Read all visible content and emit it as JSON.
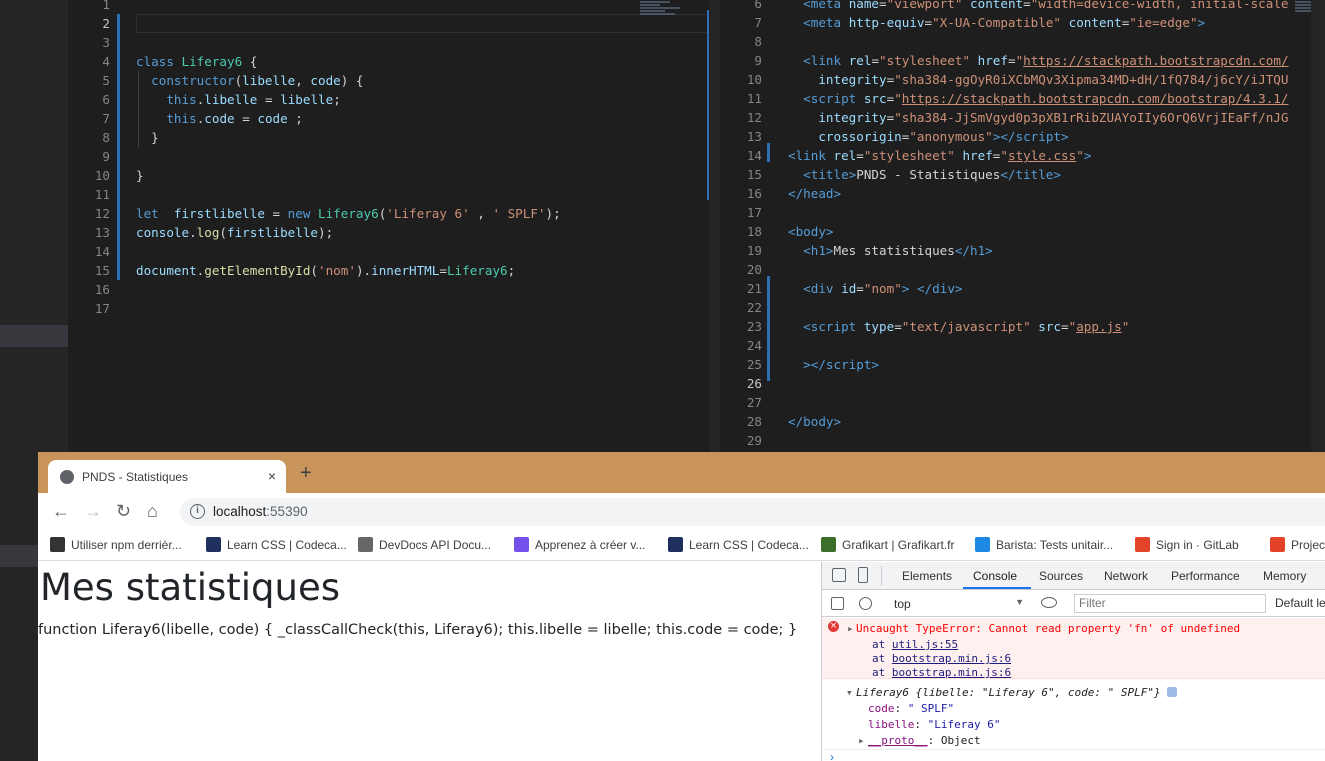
{
  "left_editor": {
    "lines": [
      {
        "n": "1",
        "html": ""
      },
      {
        "n": "2",
        "html": ""
      },
      {
        "n": "3",
        "html": ""
      },
      {
        "n": "4",
        "html": "<span class='t-key'>class</span> <span class='t-cls'>Liferay6</span> {"
      },
      {
        "n": "5",
        "html": "  <span class='t-key'>constructor</span>(<span class='t-var'>libelle</span>, <span class='t-var'>code</span>) {"
      },
      {
        "n": "6",
        "html": "    <span class='t-key'>this</span>.<span class='t-var'>libelle</span> = <span class='t-var'>libelle</span>;"
      },
      {
        "n": "7",
        "html": "    <span class='t-key'>this</span>.<span class='t-var'>code</span> = <span class='t-var'>code</span> ;"
      },
      {
        "n": "8",
        "html": "  }"
      },
      {
        "n": "9",
        "html": ""
      },
      {
        "n": "10",
        "html": "}"
      },
      {
        "n": "11",
        "html": ""
      },
      {
        "n": "12",
        "html": "<span class='t-key'>let</span>  <span class='t-var'>firstlibelle</span> = <span class='t-key'>new</span> <span class='t-cls'>Liferay6</span>(<span class='t-str'>'Liferay 6'</span> , <span class='t-str'>' SPLF'</span>);"
      },
      {
        "n": "13",
        "html": "<span class='t-var'>console</span>.<span class='t-fn'>log</span>(<span class='t-var'>firstlibelle</span>);"
      },
      {
        "n": "14",
        "html": ""
      },
      {
        "n": "15",
        "html": "<span class='t-var'>document</span>.<span class='t-fn'>getElementById</span>(<span class='t-str'>'nom'</span>).<span class='t-var'>innerHTML</span>=<span class='t-cls'>Liferay6</span>;"
      },
      {
        "n": "16",
        "html": ""
      },
      {
        "n": "17",
        "html": ""
      }
    ]
  },
  "right_editor": {
    "lines": [
      {
        "n": "6",
        "html": "  <span class='t-tag'>&lt;meta</span> <span class='t-attr'>name</span>=<span class='t-aval'>\"viewport\"</span> <span class='t-attr'>content</span>=<span class='t-aval'>\"width=device-width, initial-scale</span>"
      },
      {
        "n": "7",
        "html": "  <span class='t-tag'>&lt;meta</span> <span class='t-attr'>http-equiv</span>=<span class='t-aval'>\"X-UA-Compatible\"</span> <span class='t-attr'>content</span>=<span class='t-aval'>\"ie=edge\"</span><span class='t-tag'>&gt;</span>"
      },
      {
        "n": "8",
        "html": ""
      },
      {
        "n": "9",
        "html": "  <span class='t-tag'>&lt;link</span> <span class='t-attr'>rel</span>=<span class='t-aval'>\"stylesheet\"</span> <span class='t-attr'>href</span>=<span class='t-aval'>\"</span><span class='t-lnk'>https://stackpath.bootstrapcdn.com/</span>"
      },
      {
        "n": "10",
        "html": "    <span class='t-attr'>integrity</span>=<span class='t-aval'>\"sha384-ggOyR0iXCbMQv3Xipma34MD+dH/1fQ784/j6cY/iJTQU</span>"
      },
      {
        "n": "11",
        "html": "  <span class='t-tag'>&lt;script</span> <span class='t-attr'>src</span>=<span class='t-aval'>\"</span><span class='t-lnk'>https://stackpath.bootstrapcdn.com/bootstrap/4.3.1/</span>"
      },
      {
        "n": "12",
        "html": "    <span class='t-attr'>integrity</span>=<span class='t-aval'>\"sha384-JjSmVgyd0p3pXB1rRibZUAYoIIy6OrQ6VrjIEaFf/nJG</span>"
      },
      {
        "n": "13",
        "html": "    <span class='t-attr'>crossorigin</span>=<span class='t-aval'>\"anonymous\"</span><span class='t-tag'>&gt;&lt;/script&gt;</span>"
      },
      {
        "n": "14",
        "html": "<span class='t-tag'>&lt;link</span> <span class='t-attr'>rel</span>=<span class='t-aval'>\"stylesheet\"</span> <span class='t-attr'>href</span>=<span class='t-aval'>\"</span><span class='t-lnk'>style.css</span><span class='t-aval'>\"</span><span class='t-tag'>&gt;</span>"
      },
      {
        "n": "15",
        "html": "  <span class='t-tag'>&lt;title&gt;</span>PNDS - Statistiques<span class='t-tag'>&lt;/title&gt;</span>"
      },
      {
        "n": "16",
        "html": "<span class='t-tag'>&lt;/head&gt;</span>"
      },
      {
        "n": "17",
        "html": ""
      },
      {
        "n": "18",
        "html": "<span class='t-tag'>&lt;body&gt;</span>"
      },
      {
        "n": "19",
        "html": "  <span class='t-tag'>&lt;h1&gt;</span>Mes statistiques<span class='t-tag'>&lt;/h1&gt;</span>"
      },
      {
        "n": "20",
        "html": ""
      },
      {
        "n": "21",
        "html": "  <span class='t-tag'>&lt;div</span> <span class='t-attr'>id</span>=<span class='t-aval'>\"nom\"</span><span class='t-tag'>&gt;</span> <span class='t-tag'>&lt;/div&gt;</span>"
      },
      {
        "n": "22",
        "html": ""
      },
      {
        "n": "23",
        "html": "  <span class='t-tag'>&lt;script</span> <span class='t-attr'>type</span>=<span class='t-aval'>\"text/javascript\"</span> <span class='t-attr'>src</span>=<span class='t-aval'>\"</span><span class='t-lnk'>app.js</span><span class='t-aval'>\"</span>"
      },
      {
        "n": "24",
        "html": ""
      },
      {
        "n": "25",
        "html": "  <span class='t-tag'>&gt;&lt;/script&gt;</span>"
      },
      {
        "n": "26",
        "html": ""
      },
      {
        "n": "27",
        "html": ""
      },
      {
        "n": "28",
        "html": "<span class='t-tag'>&lt;/body&gt;</span>"
      },
      {
        "n": "29",
        "html": ""
      }
    ]
  },
  "browser": {
    "tab_title": "PNDS - Statistiques",
    "tab_close": "×",
    "new_tab": "+",
    "url_host": "localhost",
    "url_port": ":55390",
    "back": "←",
    "forward": "→",
    "reload": "↻",
    "home": "⌂",
    "bookmarks": [
      {
        "label": "Utiliser npm derrièr...",
        "color": "#333333"
      },
      {
        "label": "Learn CSS | Codeca...",
        "color": "#1f305e"
      },
      {
        "label": "DevDocs API Docu...",
        "color": "#666666"
      },
      {
        "label": "Apprenez à créer v...",
        "color": "#7451eb"
      },
      {
        "label": "Learn CSS | Codeca...",
        "color": "#1f305e"
      },
      {
        "label": "Grafikart | Grafikart.fr",
        "color": "#3b6e2b"
      },
      {
        "label": "Barista: Tests unitair...",
        "color": "#1e88e5"
      },
      {
        "label": "Sign in · GitLab",
        "color": "#e24329"
      },
      {
        "label": "Projects · I",
        "color": "#e24329"
      }
    ]
  },
  "page": {
    "heading": "Mes statistiques",
    "output": "function Liferay6(libelle, code) { _classCallCheck(this, Liferay6); this.libelle = libelle; this.code = code; }"
  },
  "devtools": {
    "tabs": [
      "Elements",
      "Console",
      "Sources",
      "Network",
      "Performance",
      "Memory"
    ],
    "active_tab": "Console",
    "context": "top",
    "filter_placeholder": "Filter",
    "levels": "Default le",
    "error_message": "Uncaught TypeError: Cannot read property 'fn' of undefined",
    "stack": [
      {
        "prefix": "at ",
        "link": "util.js:55"
      },
      {
        "prefix": "at ",
        "link": "bootstrap.min.js:6"
      },
      {
        "prefix": "at ",
        "link": "bootstrap.min.js:6"
      }
    ],
    "object_summary": "Liferay6 {libelle: \"Liferay 6\", code: \" SPLF\"}",
    "prop_code_key": "code",
    "prop_code_val": "\" SPLF\"",
    "prop_libelle_key": "libelle",
    "prop_libelle_val": "\"Liferay 6\"",
    "proto_key": "__proto__",
    "proto_val": "Object",
    "prompt": "›"
  }
}
